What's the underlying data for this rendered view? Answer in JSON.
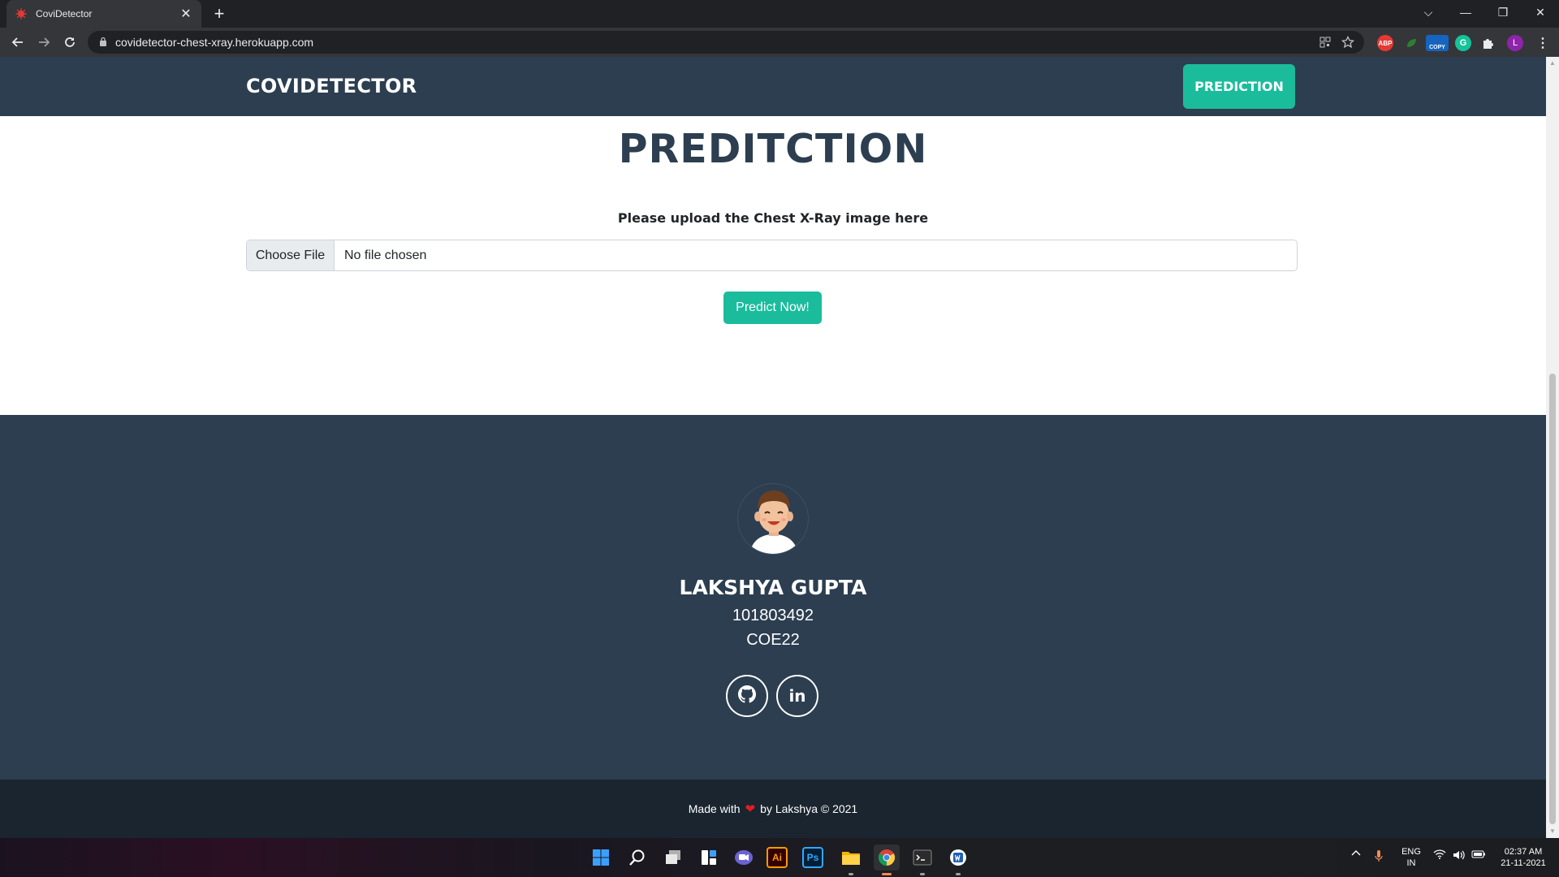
{
  "browser": {
    "tab_title": "CoviDetector",
    "tab_close": "✕",
    "new_tab": "+",
    "url": "covidetector-chest-xray.herokuapp.com",
    "window_controls": {
      "dropdown": "⌵",
      "minimize": "—",
      "restore": "❐",
      "close": "✕"
    },
    "extensions": {
      "abp": "ABP",
      "copy": "COPY",
      "grammarly": "G",
      "profile": "L"
    }
  },
  "site": {
    "brand": "COVIDETECTOR",
    "nav_button": "PREDICTION",
    "heading": "PREDITCTION",
    "upload_label": "Please upload the Chest X-Ray image here",
    "file_button": "Choose File",
    "file_status": "No file chosen",
    "predict_button": "Predict Now!"
  },
  "footer": {
    "name": "LAKSHYA GUPTA",
    "roll": "101803492",
    "group": "COE22",
    "social": [
      {
        "icon": "github-icon"
      },
      {
        "icon": "linkedin-icon",
        "label": "in"
      }
    ],
    "made_with": "Made with",
    "heart": "❤",
    "by_line": "by Lakshya © 2021"
  },
  "taskbar": {
    "apps": [
      "start",
      "search",
      "task-view",
      "widgets",
      "chat",
      "illustrator",
      "photoshop",
      "file-explorer",
      "chrome",
      "terminal",
      "word"
    ],
    "illustrator_label": "Ai",
    "photoshop_label": "Ps",
    "lang_top": "ENG",
    "lang_bottom": "IN",
    "time": "02:37 AM",
    "date": "21-11-2021"
  },
  "colors": {
    "navy": "#2c3e50",
    "teal": "#1abc9c",
    "dark_footer": "#1a252f"
  }
}
